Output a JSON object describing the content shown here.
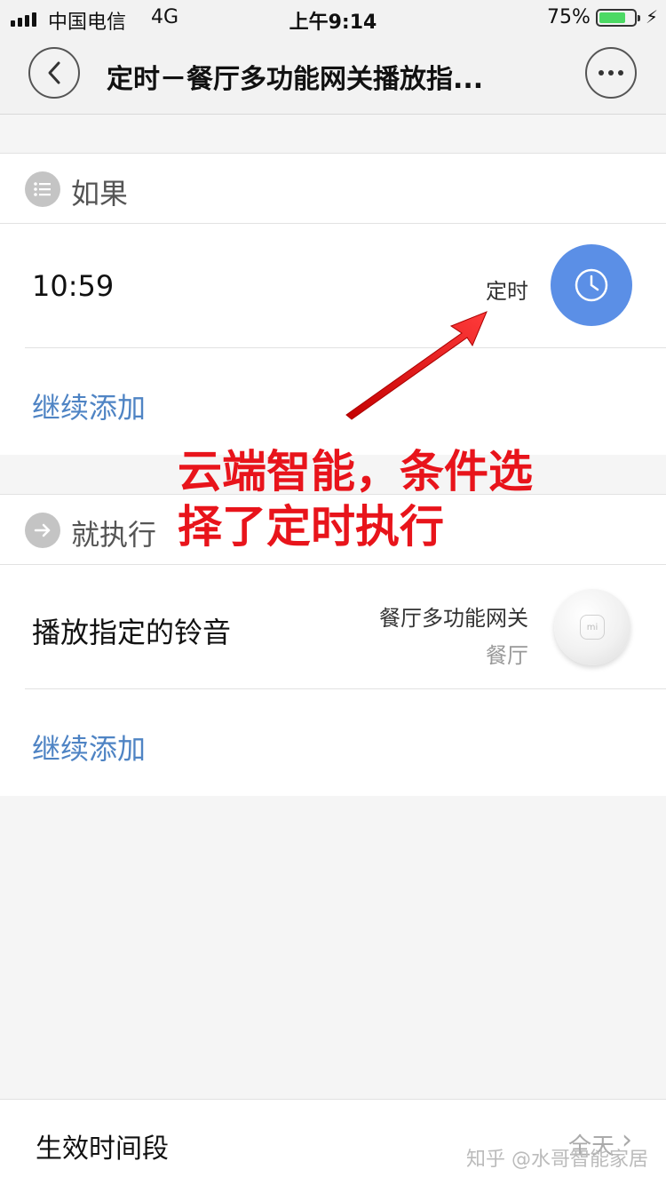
{
  "status_bar": {
    "carrier": "中国电信",
    "network": "4G",
    "time": "上午9:14",
    "battery_pct": "75%",
    "battery_level": 0.75,
    "battery_color": "#4cd964"
  },
  "nav": {
    "title": "定时－餐厅多功能网关播放指..."
  },
  "if_section": {
    "title": "如果",
    "condition": {
      "time": "10:59",
      "type": "定时"
    },
    "add_label": "继续添加"
  },
  "then_section": {
    "title": "就执行",
    "action": {
      "label": "播放指定的铃音",
      "device": "餐厅多功能网关",
      "room": "餐厅"
    },
    "add_label": "继续添加"
  },
  "annotation": {
    "line1": "云端智能，条件选",
    "line2": "择了定时执行",
    "color": "#e8141b"
  },
  "bottom": {
    "label": "生效时间段",
    "value": "全天"
  },
  "watermark": "知乎 @水哥智能家居"
}
